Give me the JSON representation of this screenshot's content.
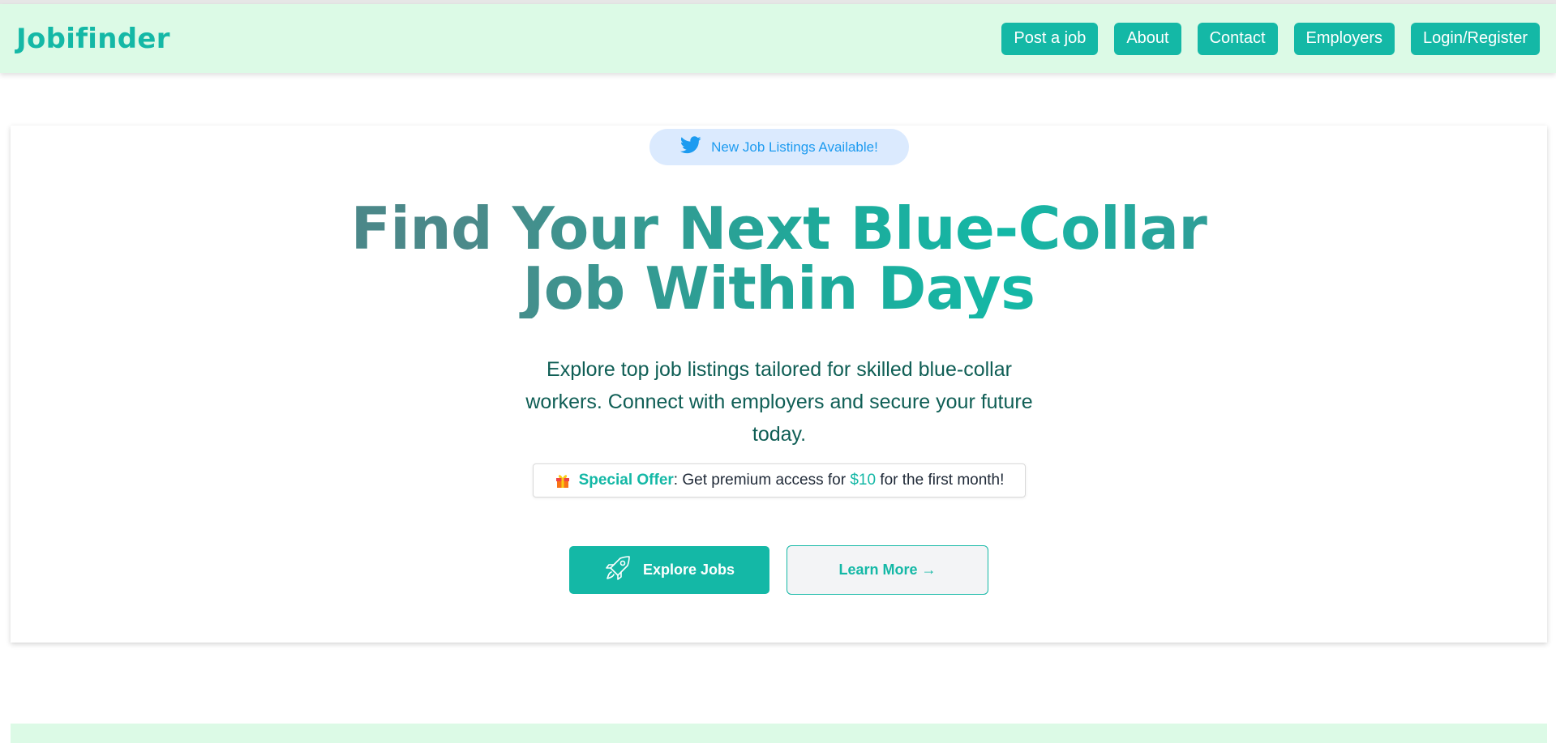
{
  "navbar": {
    "brand": "Jobifinder",
    "links": [
      "Post a job",
      "About",
      "Contact",
      "Employers",
      "Login/Register"
    ]
  },
  "hero": {
    "badge": {
      "icon": "twitter-bird-icon",
      "text": "New Job Listings Available!"
    },
    "headline_line1": "Find Your Next Blue-Collar",
    "headline_line2": "Job Within Days",
    "subtext": "Explore top job listings tailored for skilled blue-collar workers. Connect with employers and secure your future today.",
    "offer": {
      "icon": "gift-icon",
      "label": "Special Offer",
      "text_before": ": Get premium access for ",
      "price": "$10",
      "text_after": " for the first month!"
    },
    "primary_button": {
      "icon": "rocket-icon",
      "label": "Explore Jobs"
    },
    "secondary_button": {
      "label": "Learn More →"
    }
  },
  "colors": {
    "accent": "#14b8a6",
    "navbar_bg": "#dcfae6",
    "badge_bg": "#dbeafe",
    "badge_text": "#1d9bf0"
  }
}
